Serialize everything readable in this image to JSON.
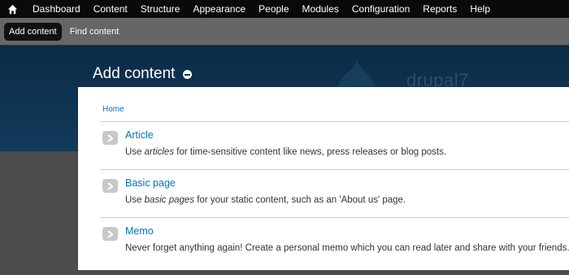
{
  "toolbar": {
    "home_icon": "home-icon",
    "items": [
      "Dashboard",
      "Content",
      "Structure",
      "Appearance",
      "People",
      "Modules",
      "Configuration",
      "Reports",
      "Help"
    ]
  },
  "shortcuts": {
    "items": [
      "Add content",
      "Find content"
    ]
  },
  "header": {
    "title": "Add content",
    "brand": "drupal7",
    "colors": {
      "header_bg": "#0f3554",
      "toolbar_bg": "#0a0a0a",
      "shortcut_bg": "#666666",
      "link": "#0074bd"
    }
  },
  "breadcrumb": "Home",
  "content_types": [
    {
      "title": "Article",
      "desc_before": "Use ",
      "desc_em": "articles",
      "desc_after": " for time-sensitive content like news, press releases or blog posts."
    },
    {
      "title": "Basic page",
      "desc_before": "Use ",
      "desc_em": "basic pages",
      "desc_after": " for your static content, such as an 'About us' page."
    },
    {
      "title": "Memo",
      "desc_before": "Never forget anything again! Create a personal memo which you can read later and share with your friends.",
      "desc_em": "",
      "desc_after": ""
    }
  ]
}
